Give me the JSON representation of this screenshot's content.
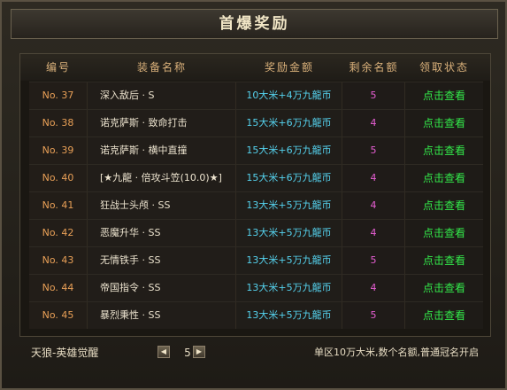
{
  "title": "首爆奖励",
  "columns": [
    "编号",
    "装备名称",
    "奖励金额",
    "剩余名额",
    "领取状态"
  ],
  "rows": [
    {
      "no": "No. 37",
      "name": "深入敌后 · S",
      "reward": "10大米+4万九龍币",
      "left": "5",
      "status": "点击查看"
    },
    {
      "no": "No. 38",
      "name": "诺克萨斯 · 致命打击",
      "reward": "15大米+6万九龍币",
      "left": "4",
      "status": "点击查看"
    },
    {
      "no": "No. 39",
      "name": "诺克萨斯 · 横中直撞",
      "reward": "15大米+6万九龍币",
      "left": "5",
      "status": "点击查看"
    },
    {
      "no": "No. 40",
      "name": "[★九龍 · 倍攻斗笠(10.0)★]",
      "reward": "15大米+6万九龍币",
      "left": "4",
      "status": "点击查看"
    },
    {
      "no": "No. 41",
      "name": "狂战士头颅 · SS",
      "reward": "13大米+5万九龍币",
      "left": "4",
      "status": "点击查看"
    },
    {
      "no": "No. 42",
      "name": "恶魔升华 · SS",
      "reward": "13大米+5万九龍币",
      "left": "4",
      "status": "点击查看"
    },
    {
      "no": "No. 43",
      "name": "无情铁手 · SS",
      "reward": "13大米+5万九龍币",
      "left": "5",
      "status": "点击查看"
    },
    {
      "no": "No. 44",
      "name": "帝国指令 · SS",
      "reward": "13大米+5万九龍币",
      "left": "4",
      "status": "点击查看"
    },
    {
      "no": "No. 45",
      "name": "暴烈秉性 · SS",
      "reward": "13大米+5万九龍币",
      "left": "5",
      "status": "点击查看"
    }
  ],
  "footer": {
    "server": "天狼-英雄觉醒",
    "prev_icon": "◀",
    "next_icon": "▶",
    "page": "5",
    "note": "单区10万大米,数个名额,普通冠名开启"
  }
}
